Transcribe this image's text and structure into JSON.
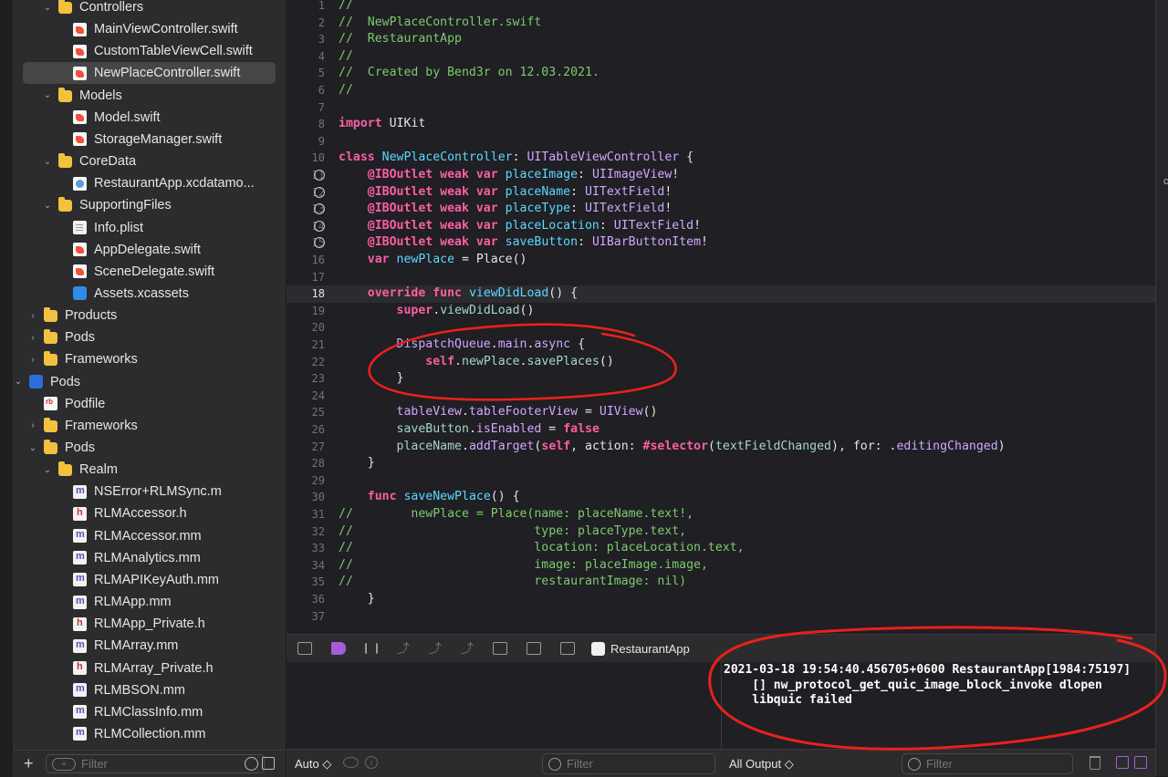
{
  "navigator": {
    "items": [
      {
        "label": "Controllers",
        "kind": "folder",
        "indent": 1,
        "disclosure": "expanded"
      },
      {
        "label": "MainViewController.swift",
        "kind": "swift",
        "indent": 2,
        "disclosure": ""
      },
      {
        "label": "CustomTableViewCell.swift",
        "kind": "swift",
        "indent": 2,
        "disclosure": ""
      },
      {
        "label": "NewPlaceController.swift",
        "kind": "swift",
        "indent": 2,
        "disclosure": "",
        "selected": true
      },
      {
        "label": "Models",
        "kind": "folder",
        "indent": 1,
        "disclosure": "expanded"
      },
      {
        "label": "Model.swift",
        "kind": "swift",
        "indent": 2,
        "disclosure": ""
      },
      {
        "label": "StorageManager.swift",
        "kind": "swift",
        "indent": 2,
        "disclosure": ""
      },
      {
        "label": "CoreData",
        "kind": "folder",
        "indent": 1,
        "disclosure": "expanded"
      },
      {
        "label": "RestaurantApp.xcdatamo...",
        "kind": "xcdata",
        "indent": 2,
        "disclosure": ""
      },
      {
        "label": "SupportingFiles",
        "kind": "folder",
        "indent": 1,
        "disclosure": "expanded"
      },
      {
        "label": "Info.plist",
        "kind": "plist",
        "indent": 2,
        "disclosure": ""
      },
      {
        "label": "AppDelegate.swift",
        "kind": "swift",
        "indent": 2,
        "disclosure": ""
      },
      {
        "label": "SceneDelegate.swift",
        "kind": "swift",
        "indent": 2,
        "disclosure": ""
      },
      {
        "label": "Assets.xcassets",
        "kind": "assets",
        "indent": 2,
        "disclosure": ""
      },
      {
        "label": "Products",
        "kind": "folder",
        "indent": 0,
        "disclosure": "collapsed"
      },
      {
        "label": "Pods",
        "kind": "folder",
        "indent": 0,
        "disclosure": "collapsed"
      },
      {
        "label": "Frameworks",
        "kind": "folder",
        "indent": 0,
        "disclosure": "collapsed"
      },
      {
        "label": "Pods",
        "kind": "proj",
        "indent": -1,
        "disclosure": "expanded"
      },
      {
        "label": "Podfile",
        "kind": "podfile",
        "indent": 0,
        "disclosure": ""
      },
      {
        "label": "Frameworks",
        "kind": "folder",
        "indent": 0,
        "disclosure": "collapsed"
      },
      {
        "label": "Pods",
        "kind": "folder",
        "indent": 0,
        "disclosure": "expanded"
      },
      {
        "label": "Realm",
        "kind": "folder",
        "indent": 1,
        "disclosure": "expanded"
      },
      {
        "label": "NSError+RLMSync.m",
        "kind": "mfile",
        "indent": 2,
        "disclosure": ""
      },
      {
        "label": "RLMAccessor.h",
        "kind": "hfile",
        "indent": 2,
        "disclosure": ""
      },
      {
        "label": "RLMAccessor.mm",
        "kind": "mfile",
        "indent": 2,
        "disclosure": ""
      },
      {
        "label": "RLMAnalytics.mm",
        "kind": "mfile",
        "indent": 2,
        "disclosure": ""
      },
      {
        "label": "RLMAPIKeyAuth.mm",
        "kind": "mfile",
        "indent": 2,
        "disclosure": ""
      },
      {
        "label": "RLMApp.mm",
        "kind": "mfile",
        "indent": 2,
        "disclosure": ""
      },
      {
        "label": "RLMApp_Private.h",
        "kind": "hfile",
        "indent": 2,
        "disclosure": ""
      },
      {
        "label": "RLMArray.mm",
        "kind": "mfile",
        "indent": 2,
        "disclosure": ""
      },
      {
        "label": "RLMArray_Private.h",
        "kind": "hfile",
        "indent": 2,
        "disclosure": ""
      },
      {
        "label": "RLMBSON.mm",
        "kind": "mfile",
        "indent": 2,
        "disclosure": ""
      },
      {
        "label": "RLMClassInfo.mm",
        "kind": "mfile",
        "indent": 2,
        "disclosure": ""
      },
      {
        "label": "RLMCollection.mm",
        "kind": "mfile",
        "indent": 2,
        "disclosure": ""
      }
    ],
    "add_label": "+",
    "filter_placeholder": "Filter"
  },
  "editor": {
    "current_line": 18,
    "lines": [
      {
        "n": 1,
        "tokens": [
          [
            "c",
            "//"
          ]
        ]
      },
      {
        "n": 2,
        "tokens": [
          [
            "c",
            "//  NewPlaceController.swift"
          ]
        ]
      },
      {
        "n": 3,
        "tokens": [
          [
            "c",
            "//  RestaurantApp"
          ]
        ]
      },
      {
        "n": 4,
        "tokens": [
          [
            "c",
            "//"
          ]
        ]
      },
      {
        "n": 5,
        "tokens": [
          [
            "c",
            "//  Created by Bend3r on 12.03.2021."
          ]
        ]
      },
      {
        "n": 6,
        "tokens": [
          [
            "c",
            "//"
          ]
        ]
      },
      {
        "n": 7,
        "tokens": []
      },
      {
        "n": 8,
        "tokens": [
          [
            "k",
            "import"
          ],
          [
            "p",
            " UIKit"
          ]
        ]
      },
      {
        "n": 9,
        "tokens": []
      },
      {
        "n": 10,
        "tokens": [
          [
            "k",
            "class"
          ],
          [
            "p",
            " "
          ],
          [
            "d",
            "NewPlaceController"
          ],
          [
            "p",
            ": "
          ],
          [
            "t",
            "UITableViewController"
          ],
          [
            "p",
            " {"
          ]
        ]
      },
      {
        "n": 11,
        "outlet": true,
        "tokens": [
          [
            "p",
            "    "
          ],
          [
            "k",
            "@IBOutlet weak var"
          ],
          [
            "p",
            " "
          ],
          [
            "d",
            "placeImage"
          ],
          [
            "p",
            ": "
          ],
          [
            "t",
            "UIImageView"
          ],
          [
            "p",
            "!"
          ]
        ]
      },
      {
        "n": 12,
        "outlet": true,
        "tokens": [
          [
            "p",
            "    "
          ],
          [
            "k",
            "@IBOutlet weak var"
          ],
          [
            "p",
            " "
          ],
          [
            "d",
            "placeName"
          ],
          [
            "p",
            ": "
          ],
          [
            "t",
            "UITextField"
          ],
          [
            "p",
            "!"
          ]
        ]
      },
      {
        "n": 13,
        "outlet": true,
        "tokens": [
          [
            "p",
            "    "
          ],
          [
            "k",
            "@IBOutlet weak var"
          ],
          [
            "p",
            " "
          ],
          [
            "d",
            "placeType"
          ],
          [
            "p",
            ": "
          ],
          [
            "t",
            "UITextField"
          ],
          [
            "p",
            "!"
          ]
        ]
      },
      {
        "n": 14,
        "outlet": true,
        "tokens": [
          [
            "p",
            "    "
          ],
          [
            "k",
            "@IBOutlet weak var"
          ],
          [
            "p",
            " "
          ],
          [
            "d",
            "placeLocation"
          ],
          [
            "p",
            ": "
          ],
          [
            "t",
            "UITextField"
          ],
          [
            "p",
            "!"
          ]
        ]
      },
      {
        "n": 15,
        "outlet": true,
        "tokens": [
          [
            "p",
            "    "
          ],
          [
            "k",
            "@IBOutlet weak var"
          ],
          [
            "p",
            " "
          ],
          [
            "d",
            "saveButton"
          ],
          [
            "p",
            ": "
          ],
          [
            "t",
            "UIBarButtonItem"
          ],
          [
            "p",
            "!"
          ]
        ]
      },
      {
        "n": 16,
        "tokens": [
          [
            "p",
            "    "
          ],
          [
            "k",
            "var"
          ],
          [
            "p",
            " "
          ],
          [
            "d",
            "newPlace"
          ],
          [
            "p",
            " = "
          ],
          [
            "p",
            "Place()"
          ]
        ]
      },
      {
        "n": 17,
        "tokens": []
      },
      {
        "n": 18,
        "tokens": [
          [
            "p",
            "    "
          ],
          [
            "k",
            "override func"
          ],
          [
            "p",
            " "
          ],
          [
            "d",
            "viewDidLoad"
          ],
          [
            "p",
            "() {"
          ]
        ]
      },
      {
        "n": 19,
        "tokens": [
          [
            "p",
            "        "
          ],
          [
            "k",
            "super"
          ],
          [
            "p",
            "."
          ],
          [
            "m",
            "viewDidLoad"
          ],
          [
            "p",
            "()"
          ]
        ]
      },
      {
        "n": 20,
        "tokens": []
      },
      {
        "n": 21,
        "tokens": [
          [
            "p",
            "        "
          ],
          [
            "t",
            "DispatchQueue"
          ],
          [
            "p",
            "."
          ],
          [
            "t",
            "main"
          ],
          [
            "p",
            "."
          ],
          [
            "t",
            "async"
          ],
          [
            "p",
            " {"
          ]
        ]
      },
      {
        "n": 22,
        "tokens": [
          [
            "p",
            "            "
          ],
          [
            "k",
            "self"
          ],
          [
            "p",
            "."
          ],
          [
            "m",
            "newPlace"
          ],
          [
            "p",
            "."
          ],
          [
            "m",
            "savePlaces"
          ],
          [
            "p",
            "()"
          ]
        ]
      },
      {
        "n": 23,
        "tokens": [
          [
            "p",
            "        }"
          ]
        ]
      },
      {
        "n": 24,
        "tokens": []
      },
      {
        "n": 25,
        "tokens": [
          [
            "p",
            "        "
          ],
          [
            "t",
            "tableView"
          ],
          [
            "p",
            "."
          ],
          [
            "t",
            "tableFooterView"
          ],
          [
            "p",
            " = "
          ],
          [
            "t",
            "UIView"
          ],
          [
            "p",
            "()"
          ]
        ]
      },
      {
        "n": 26,
        "tokens": [
          [
            "p",
            "        "
          ],
          [
            "m",
            "saveButton"
          ],
          [
            "p",
            "."
          ],
          [
            "t",
            "isEnabled"
          ],
          [
            "p",
            " = "
          ],
          [
            "k",
            "false"
          ]
        ]
      },
      {
        "n": 27,
        "tokens": [
          [
            "p",
            "        "
          ],
          [
            "m",
            "placeName"
          ],
          [
            "p",
            "."
          ],
          [
            "t",
            "addTarget"
          ],
          [
            "p",
            "("
          ],
          [
            "k",
            "self"
          ],
          [
            "p",
            ", action: "
          ],
          [
            "k",
            "#selector"
          ],
          [
            "p",
            "("
          ],
          [
            "m",
            "textFieldChanged"
          ],
          [
            "p",
            "), for: ."
          ],
          [
            "t",
            "editingChanged"
          ],
          [
            "p",
            ")"
          ]
        ]
      },
      {
        "n": 28,
        "tokens": [
          [
            "p",
            "    }"
          ]
        ]
      },
      {
        "n": 29,
        "tokens": []
      },
      {
        "n": 30,
        "tokens": [
          [
            "p",
            "    "
          ],
          [
            "k",
            "func"
          ],
          [
            "p",
            " "
          ],
          [
            "d",
            "saveNewPlace"
          ],
          [
            "p",
            "() {"
          ]
        ]
      },
      {
        "n": 31,
        "tokens": [
          [
            "c",
            "//        newPlace = Place(name: placeName.text!,"
          ]
        ]
      },
      {
        "n": 32,
        "tokens": [
          [
            "c",
            "//                         type: placeType.text,"
          ]
        ]
      },
      {
        "n": 33,
        "tokens": [
          [
            "c",
            "//                         location: placeLocation.text,"
          ]
        ]
      },
      {
        "n": 34,
        "tokens": [
          [
            "c",
            "//                         image: placeImage.image,"
          ]
        ]
      },
      {
        "n": 35,
        "tokens": [
          [
            "c",
            "//                         restaurantImage: nil)"
          ]
        ]
      },
      {
        "n": 36,
        "tokens": [
          [
            "p",
            "    }"
          ]
        ]
      },
      {
        "n": 37,
        "tokens": []
      }
    ]
  },
  "debug_bar": {
    "scheme_label": "RestaurantApp"
  },
  "console": {
    "text": "2021-03-18 19:54:40.456705+0600 RestaurantApp[1984:75197]\n    [] nw_protocol_get_quic_image_block_invoke dlopen\n    libquic failed"
  },
  "bottom_bar": {
    "auto_label": "Auto ◇",
    "var_filter_placeholder": "Filter",
    "output_label": "All Output ◇",
    "console_filter_placeholder": "Filter"
  },
  "colors": {
    "annotation_red": "#e8211b",
    "comment": "#7ecb6b",
    "keyword": "#fc5fa3",
    "type": "#d0a8ff",
    "declaration": "#5dd8ff"
  }
}
